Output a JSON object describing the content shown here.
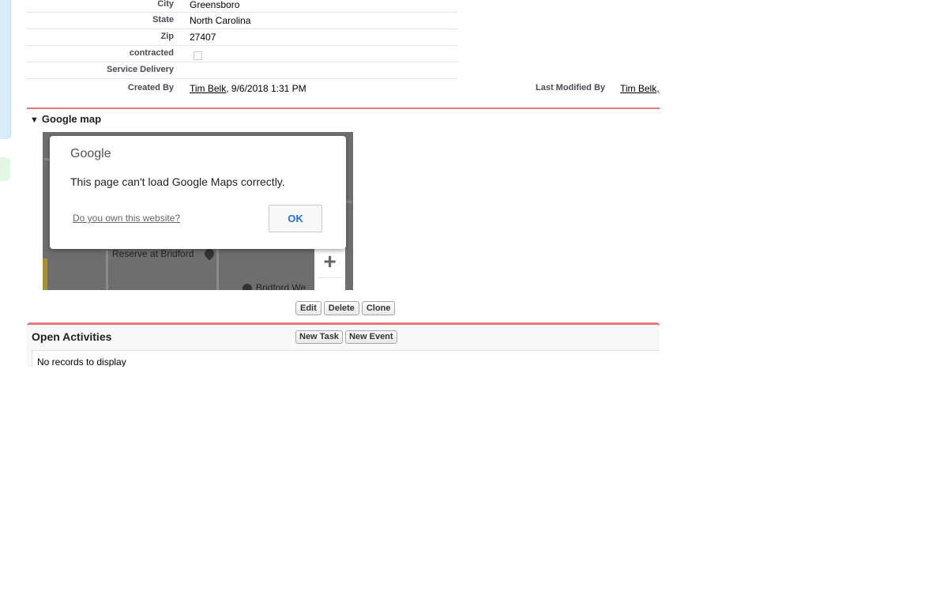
{
  "details": {
    "rows": [
      {
        "label": "City",
        "value": "Greensboro"
      },
      {
        "label": "State",
        "value": "North Carolina"
      },
      {
        "label": "Zip",
        "value": "27407"
      },
      {
        "label": "contracted",
        "value": ""
      },
      {
        "label": "Service Delivery",
        "value": ""
      }
    ],
    "created_by_label": "Created By",
    "created_by_user": "Tim Belk",
    "created_by_date": ", 9/6/2018 1:31 PM",
    "last_modified_label": "Last Modified By",
    "last_modified_user": "Tim Belk,"
  },
  "map_section": {
    "title": "Google map",
    "map_label_1": "Reserve at Bridford",
    "map_label_2": "Bridford We",
    "zoom_in": "+",
    "dialog": {
      "logo": "Google",
      "message": "This page can't load Google Maps correctly.",
      "own_link": "Do you own this website?",
      "ok_label": "OK"
    }
  },
  "buttons": {
    "edit": "Edit",
    "delete": "Delete",
    "clone": "Clone"
  },
  "open_activities": {
    "title": "Open Activities",
    "new_task": "New Task",
    "new_event": "New Event",
    "empty_text": "No records to display"
  },
  "colors": {
    "section_accent": "#e8767f",
    "dialog_ok": "#1a73e8"
  }
}
